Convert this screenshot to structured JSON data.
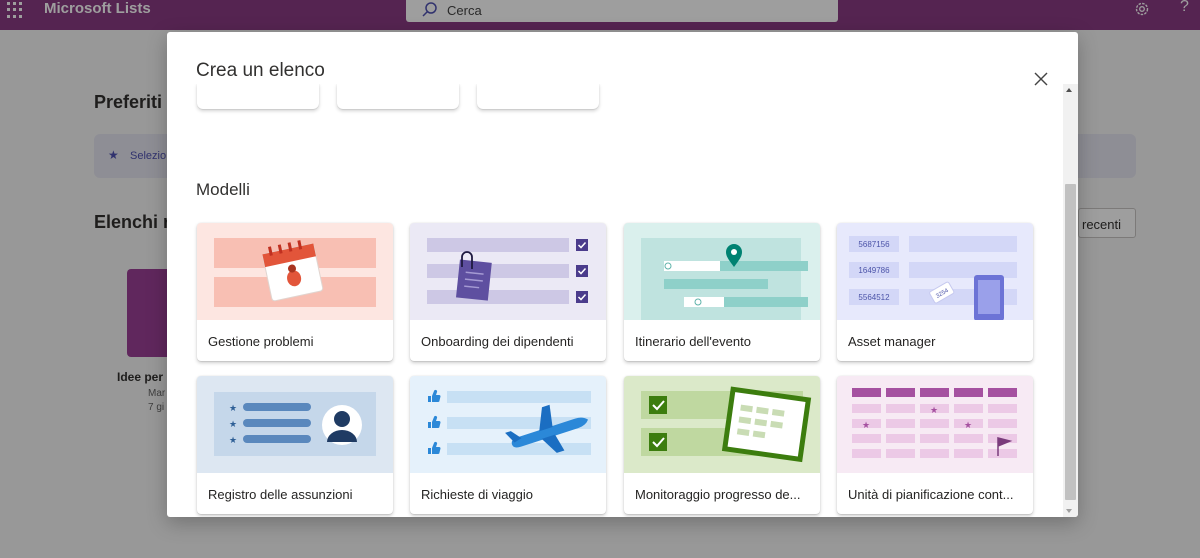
{
  "app": {
    "name": "Microsoft Lists"
  },
  "search": {
    "placeholder": "Cerca"
  },
  "background": {
    "favorites_heading": "Preferiti",
    "banner_text": "Selezio",
    "recent_heading": "Elenchi re",
    "recent_button": "recenti",
    "tile_title": "Idee per",
    "tile_sub1": "Mar",
    "tile_sub2": "7 gi"
  },
  "dialog": {
    "title": "Crea un elenco",
    "section_title": "Modelli",
    "templates": [
      {
        "label": "Gestione problemi"
      },
      {
        "label": "Onboarding dei dipendenti"
      },
      {
        "label": "Itinerario dell'evento"
      },
      {
        "label": "Asset manager"
      },
      {
        "label": "Registro delle assunzioni"
      },
      {
        "label": "Richieste di viaggio"
      },
      {
        "label": "Monitoraggio progresso de..."
      },
      {
        "label": "Unità di pianificazione cont..."
      }
    ],
    "asset_numbers": [
      "5687156",
      "1649786",
      "5564512"
    ],
    "asset_tag": "3254"
  },
  "colors": {
    "brand": "#8a3a84",
    "accent_purple": "#4f52b2"
  }
}
